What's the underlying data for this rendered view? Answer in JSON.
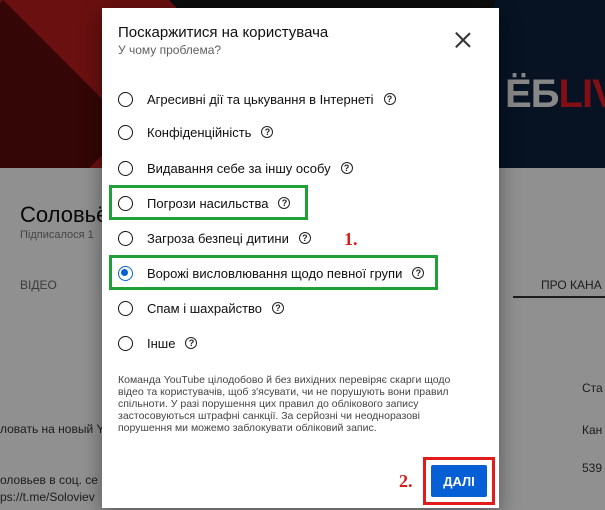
{
  "background": {
    "banner_logo_white": "ЁБ",
    "banner_logo_red": "LIV",
    "channel_name": "Соловьё",
    "channel_sub": "Підписалося 1",
    "tab_video": "ВІДЕО",
    "tab_about": "ПРО КАНА",
    "lines": [
      "ловать на новый Y",
      "оловьев в соц. се",
      "ps://t.me/Soloviev",
      "Ста",
      "Кан",
      "539"
    ]
  },
  "dialog": {
    "title": "Поскаржитися на користувача",
    "subtitle": "У чому проблема?",
    "options": [
      {
        "label": "Агресивні дії та цькування в Інтернеті",
        "selected": false
      },
      {
        "label": "Конфіденційність",
        "selected": false
      },
      {
        "label": "Видавання себе за іншу особу",
        "selected": false
      },
      {
        "label": "Погрози насильства",
        "selected": false
      },
      {
        "label": "Загроза безпеці дитини",
        "selected": false
      },
      {
        "label": "Ворожі висловлювання щодо певної групи",
        "selected": true
      },
      {
        "label": "Спам і шахрайство",
        "selected": false
      },
      {
        "label": "Інше",
        "selected": false
      }
    ],
    "help_glyph": "?",
    "info_text": "Команда YouTube цілодобово й без вихідних перевіряє скарги щодо відео та користувачів, щоб з'ясувати, чи не порушують вони правил спільноти. У разі порушення цих правил до облікового запису застосовуються штрафні санкції. За серйозні чи неодноразові порушення ми можемо заблокувати обліковий запис.",
    "next_button": "ДАЛІ"
  },
  "annotations": {
    "step1": "1.",
    "step2": "2."
  },
  "colors": {
    "accent": "#065fd4",
    "highlight_green": "#21a038",
    "highlight_red": "#e21b1b"
  }
}
